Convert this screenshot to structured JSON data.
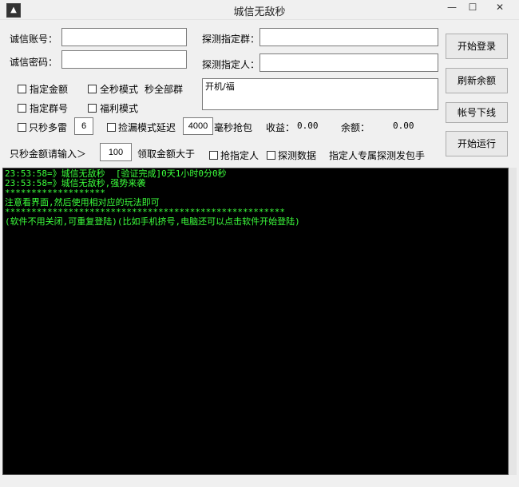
{
  "window": {
    "title": "城信无敌秒",
    "min": "—",
    "max": "☐",
    "close": "✕",
    "icon_glyph": "▲"
  },
  "account": {
    "label": "诚信账号：",
    "value": ""
  },
  "password": {
    "label": "诚信密码：",
    "value": ""
  },
  "detect_group": {
    "label": "探测指定群：",
    "value": ""
  },
  "detect_person": {
    "label": "探测指定人：",
    "value": ""
  },
  "checkboxes": {
    "amount": "指定金额",
    "full_sec": "全秒模式",
    "sec_all_groups": "秒全部群",
    "group_no": "指定群号",
    "welfare": "福利模式",
    "only_multi": "只秒多雷",
    "grab_delay": "捡漏模式延迟",
    "grab_person": "抢指定人",
    "detect_data": "探测数据"
  },
  "textarea_value": "开机/福",
  "multi_count": "6",
  "delay_ms": "4000",
  "ms_grab_label": "毫秒抢包",
  "income": {
    "label": "收益：",
    "value": "0.00"
  },
  "balance": {
    "label": "余额：",
    "value": "0.00"
  },
  "min_amount": {
    "label": "只秒金额请输入＞",
    "value": "100",
    "suffix": "领取金额大于"
  },
  "exclusive_label": "指定人专属探测发包手",
  "buttons": {
    "login": "开始登录",
    "refresh": "刷新余额",
    "logout": "帐号下线",
    "run": "开始运行"
  },
  "console_lines": [
    "23:53:58=》城信无敌秒  [验证完成]0天1小时0分0秒",
    "23:53:58=》城信无敌秒,强势来袭",
    "*******************",
    "注意看界面,然后使用相对应的玩法即可",
    "*****************************************************",
    "(软件不用关闭,可重复登陆)(比如手机挤号,电脑还可以点击软件开始登陆)"
  ]
}
